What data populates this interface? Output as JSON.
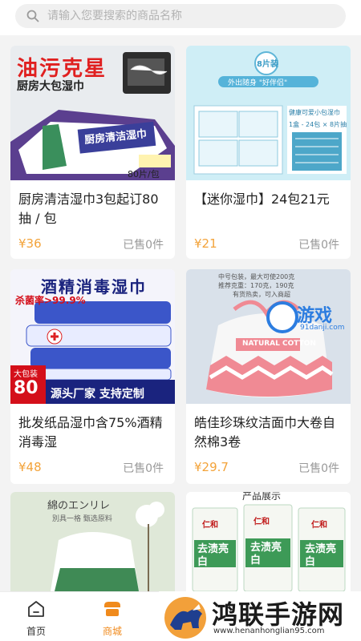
{
  "search": {
    "placeholder": "请输入您要搜索的商品名称"
  },
  "products": [
    {
      "title": "厨房清洁湿巾3包起订80抽 / 包",
      "price": "¥36",
      "sold": "已售0件",
      "image_text": {
        "headline": "油污克星",
        "sub": "厨房大包湿巾",
        "pack": "厨房清洁湿巾",
        "badge": "80片/包"
      }
    },
    {
      "title": "【迷你湿巾】24包21元",
      "price": "¥21",
      "sold": "已售0件",
      "image_text": {
        "badge": "8片装",
        "ribbon": "外出随身 \"好伴侣\"",
        "label1": "健康可爱小包湿巾",
        "label2": "1盒 - 24包 × 8片抽"
      }
    },
    {
      "title": "批发纸品湿巾含75%酒精消毒湿",
      "price": "¥48",
      "sold": "已售0件",
      "image_text": {
        "headline": "酒精消毒湿巾",
        "sub": "杀菌率>99.9%",
        "badge_top": "大包装",
        "badge_num": "80",
        "slogan": "源头厂家 支持定制"
      }
    },
    {
      "title": "皓佳珍珠纹洁面巾大卷自然棉3卷",
      "price": "¥29.7",
      "sold": "已售0件",
      "image_text": {
        "line1": "中号包装，最大可使200克",
        "line2": "推荐克重：170克，190克",
        "line3": "有货热卖，可入商超",
        "bag": "NATURAL COTTON",
        "overlay": "游戏",
        "overlay_url": "91danji.com"
      }
    },
    {
      "title": "",
      "price": "",
      "sold": "",
      "image_text": {
        "line1": "綿のエンリレ",
        "line2": "別具一格 甄选原料"
      }
    },
    {
      "title": "",
      "price": "",
      "sold": "",
      "image_text": {
        "header": "产品展示",
        "brand": "仁和",
        "tube": "去渍亮白"
      }
    }
  ],
  "tabbar": {
    "home": "首页",
    "mall": "商城"
  },
  "watermark": {
    "title": "鸿联手游网",
    "url": "www.henanhonglian95.com"
  },
  "colors": {
    "accent": "#f08a1c",
    "price": "#f3a33a"
  }
}
